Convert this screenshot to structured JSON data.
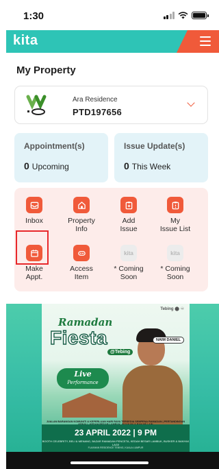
{
  "status_bar": {
    "time": "1:30"
  },
  "header": {
    "logo": "kita",
    "accent_color": "#2ec4b6",
    "menu_color": "#f05a3a"
  },
  "page": {
    "title": "My Property"
  },
  "property": {
    "name": "Ara Residence",
    "code": "PTD197656"
  },
  "summary": {
    "appointments": {
      "title": "Appointment(s)",
      "count": "0",
      "label": "Upcoming"
    },
    "issues": {
      "title": "Issue Update(s)",
      "count": "0",
      "label": "This Week"
    }
  },
  "menu": {
    "items": [
      {
        "label": "Inbox",
        "icon": "inbox-icon"
      },
      {
        "label": "Property\nInfo",
        "icon": "home-icon"
      },
      {
        "label": "Add\nIssue",
        "icon": "clipboard-add-icon"
      },
      {
        "label": "My\nIssue List",
        "icon": "clipboard-list-icon"
      },
      {
        "label": "Make\nAppt.",
        "icon": "calendar-icon"
      },
      {
        "label": "Access\nItem",
        "icon": "key-icon"
      },
      {
        "label": "* Coming\nSoon",
        "icon": "kita-placeholder-icon"
      },
      {
        "label": "* Coming\nSoon",
        "icon": "kita-placeholder-icon"
      }
    ],
    "placeholder_text": "kita"
  },
  "banner": {
    "sponsor": "Tebing ⬤ ♾",
    "ramadan": "Ramadan",
    "fiesta": "Fiesta",
    "tebing": "@Tebing",
    "live": "Live",
    "performance": "Performance",
    "name_tag": "NAIM DANIEL",
    "description": "JUALAN BARANGAN KOMUNITI & KEPERLUAN HARI RAYA TERSEDIA SEMPENA RAMADAN | PERTANDINGAN KENALI, KEDAH BESAR LAMBUK, BIJAKAN & BAKAR LAIN",
    "date": "23 APRIL 2022 | 9 PM",
    "sub": "BOOTH CELEBRITY, BELI & MENANG, BAZAR RAMADAN PENCETA, KEDAH BESAR LAMBUK, BUSKER & BANYAK LAGI!",
    "footer": "FLAXMAN RESIDENCE TEBING, KUALA LUMPUR"
  }
}
